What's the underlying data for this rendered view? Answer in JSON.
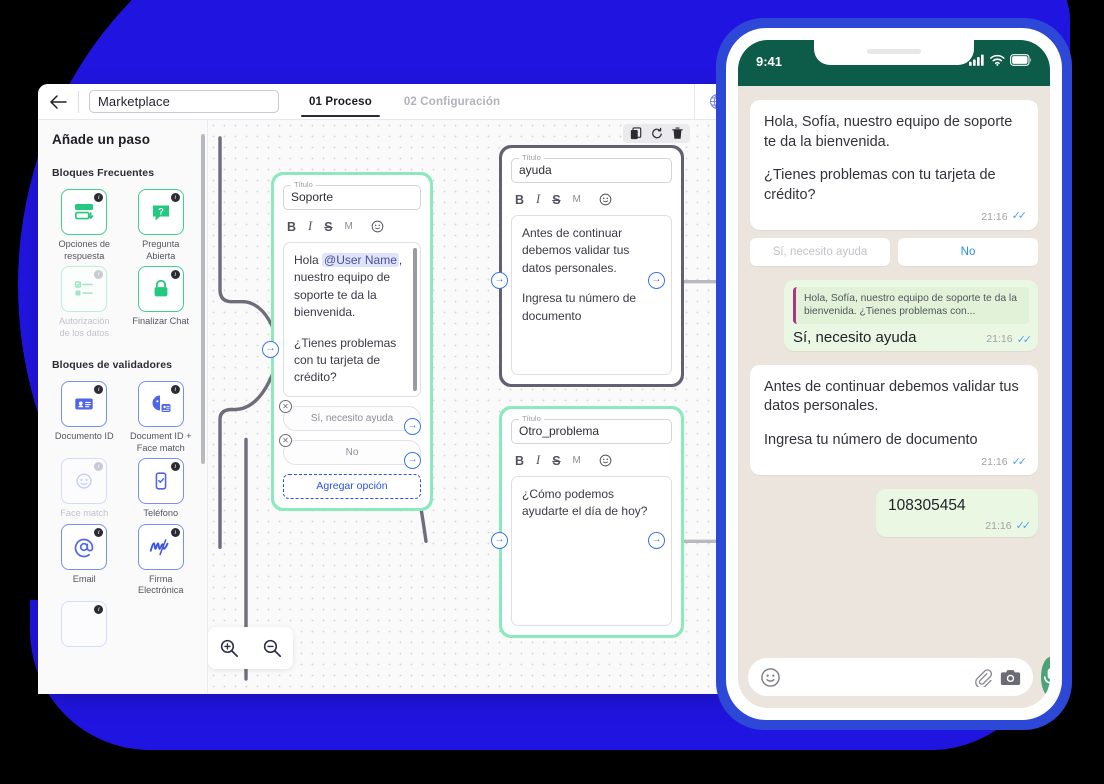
{
  "window": {
    "back_label": "←",
    "project_name": "Marketplace",
    "tabs": [
      {
        "label": "01 Proceso",
        "active": true
      },
      {
        "label": "02 Configuración",
        "active": false
      }
    ],
    "globe_icon": "globe-icon"
  },
  "sidebar": {
    "title": "Añade un paso",
    "sections": [
      {
        "label": "Bloques Frecuentes",
        "blocks": [
          {
            "label": "Opciones de respuesta",
            "icon": "answer-options-icon",
            "style": "green",
            "badge": "i",
            "enabled": true
          },
          {
            "label": "Pregunta Abierta",
            "icon": "open-question-icon",
            "style": "green",
            "badge": "i",
            "enabled": true
          },
          {
            "label": "Autorización de los datos",
            "icon": "data-authorization-icon",
            "style": "green-dim",
            "badge": "i",
            "enabled": false
          },
          {
            "label": "Finalizar Chat",
            "icon": "lock-icon",
            "style": "green",
            "badge": "i",
            "enabled": true
          }
        ]
      },
      {
        "label": "Bloques de validadores",
        "blocks": [
          {
            "label": "Documento ID",
            "icon": "id-card-icon",
            "style": "blue",
            "badge": "i",
            "enabled": true
          },
          {
            "label": "Document ID + Face match",
            "icon": "id-face-match-icon",
            "style": "blue",
            "badge": "i",
            "enabled": true
          },
          {
            "label": "Face match",
            "icon": "face-match-icon",
            "style": "blue-dim",
            "badge": "i",
            "enabled": false
          },
          {
            "label": "Teléfono",
            "icon": "phone-check-icon",
            "style": "blue",
            "badge": "i",
            "enabled": true
          },
          {
            "label": "Email",
            "icon": "email-at-icon",
            "style": "blue",
            "badge": "i",
            "enabled": true
          },
          {
            "label": "Firma Electrónica",
            "icon": "signature-icon",
            "style": "blue",
            "badge": "i",
            "enabled": true
          }
        ]
      }
    ]
  },
  "canvas": {
    "toolbar": [
      {
        "name": "copy-icon"
      },
      {
        "name": "refresh-icon"
      },
      {
        "name": "delete-icon"
      }
    ],
    "zoom_controls": [
      {
        "name": "zoom-in-icon"
      },
      {
        "name": "zoom-out-icon"
      }
    ],
    "nodes": [
      {
        "id": "soporte",
        "title_legend": "Título",
        "title_value": "Soporte",
        "format_tools": {
          "bold": "B",
          "italic": "I",
          "strike": "S",
          "markdown": "M",
          "emoji": "emoji-icon"
        },
        "message_line1_prefix": "Hola ",
        "message_mention": "@User Name",
        "message_line1_suffix": ", nuestro equipo de soporte te da la bienvenida.",
        "message_line2": "¿Tienes problemas con tu tarjeta de crédito?",
        "options": [
          {
            "label": "Sí, necesito ayuda"
          },
          {
            "label": "No"
          }
        ],
        "add_option_label": "Agregar opción"
      },
      {
        "id": "ayuda",
        "title_legend": "Título",
        "title_value": "ayuda",
        "message_line1": "Antes de continuar debemos validar tus datos personales.",
        "message_line2": "Ingresa tu número de documento"
      },
      {
        "id": "otro_problema",
        "title_legend": "Título",
        "title_value": "Otro_problema",
        "message_line1": "¿Cómo podemos ayudarte el día de hoy?"
      }
    ]
  },
  "phone": {
    "status": {
      "time": "9:41",
      "signal_icon": "cellular-icon",
      "wifi_icon": "wifi-icon",
      "battery_icon": "battery-icon"
    },
    "messages": [
      {
        "type": "incoming",
        "line1": "Hola, Sofía,  nuestro equipo de soporte te da la bienvenida.",
        "line2": "¿Tienes problemas con tu tarjeta de crédito?",
        "time": "21:16"
      }
    ],
    "quick_replies": [
      {
        "label": "Sí, necesito ayuda",
        "style": "muted"
      },
      {
        "label": "No",
        "style": "link"
      }
    ],
    "reply_bubble": {
      "quote": "Hola, Sofía,  nuestro equipo de soporte te da la bienvenida. ¿Tienes problemas con...",
      "text": "Sí, necesito ayuda",
      "time": "21:16"
    },
    "second_incoming": {
      "line1": "Antes de continuar debemos validar tus datos personales.",
      "line2": "Ingresa tu número de documento",
      "time": "21:16"
    },
    "number_bubble": {
      "text": "108305454",
      "time": "21:16"
    },
    "composer": {
      "placeholder": "",
      "emoji_icon": "emoji-icon",
      "attach_icon": "paperclip-icon",
      "camera_icon": "camera-icon",
      "mic_icon": "microphone-icon"
    }
  },
  "colors": {
    "brand_blue": "#2015e0",
    "node_green": "#8ce8bd",
    "node_gray": "#616173",
    "whatsapp_green": "#0d5b49",
    "port_blue": "#3a74e8"
  }
}
